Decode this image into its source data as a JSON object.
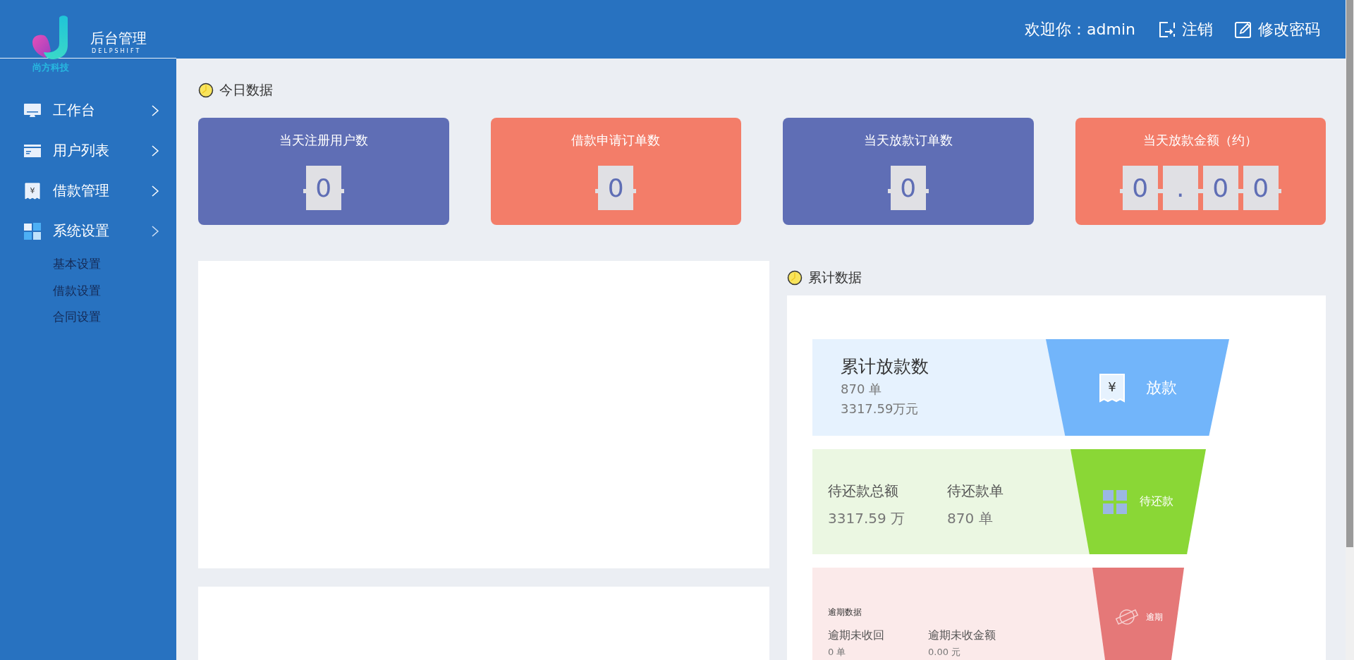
{
  "header": {
    "brand_title": "后台管理",
    "brand_subtitle": "DELPSHIFT",
    "brand_tagline": "尚方科技",
    "welcome": "欢迎你：admin",
    "actions": [
      {
        "kind": "logout",
        "label": "注销"
      },
      {
        "kind": "password",
        "label": "修改密码"
      }
    ]
  },
  "sidebar": {
    "items": [
      {
        "label": "工作台",
        "expanded": false
      },
      {
        "label": "用户列表",
        "expanded": false
      },
      {
        "label": "借款管理",
        "expanded": false,
        "icon_text": "¥"
      },
      {
        "label": "系统设置",
        "expanded": true,
        "children": [
          {
            "label": "基本设置"
          },
          {
            "label": "借款设置"
          },
          {
            "label": "合同设置"
          }
        ]
      }
    ]
  },
  "today": {
    "title": "今日数据",
    "cards": [
      {
        "title": "当天注册用户数",
        "color": "#5f6eb5",
        "digits": [
          "0"
        ]
      },
      {
        "title": "借款申请订单数",
        "color": "#f37d69",
        "digits": [
          "0"
        ]
      },
      {
        "title": "当天放款订单数",
        "color": "#5f6eb5",
        "digits": [
          "0"
        ]
      },
      {
        "title": "当天放款金额（约）",
        "color": "#f37d69",
        "digits": [
          "0",
          ".",
          "0",
          "0"
        ]
      }
    ]
  },
  "cumulative": {
    "title": "累计数据",
    "rows": [
      {
        "kind": "single",
        "title": "累计放款数",
        "lines": [
          "870 单",
          "3317.59万元"
        ],
        "icon_text": "¥",
        "segment_label": "放款"
      },
      {
        "kind": "pair",
        "columns": [
          {
            "label": "待还款总额",
            "value": "3317.59 万"
          },
          {
            "label": "待还款单",
            "value": "870 单"
          }
        ],
        "segment_label": "待还款"
      },
      {
        "kind": "section",
        "title": "逾期数据",
        "columns": [
          {
            "label": "逾期未收回",
            "value": "0 单"
          },
          {
            "label": "逾期未收金额",
            "value": "0.00 元"
          }
        ],
        "segment_label": "逾期"
      }
    ]
  }
}
